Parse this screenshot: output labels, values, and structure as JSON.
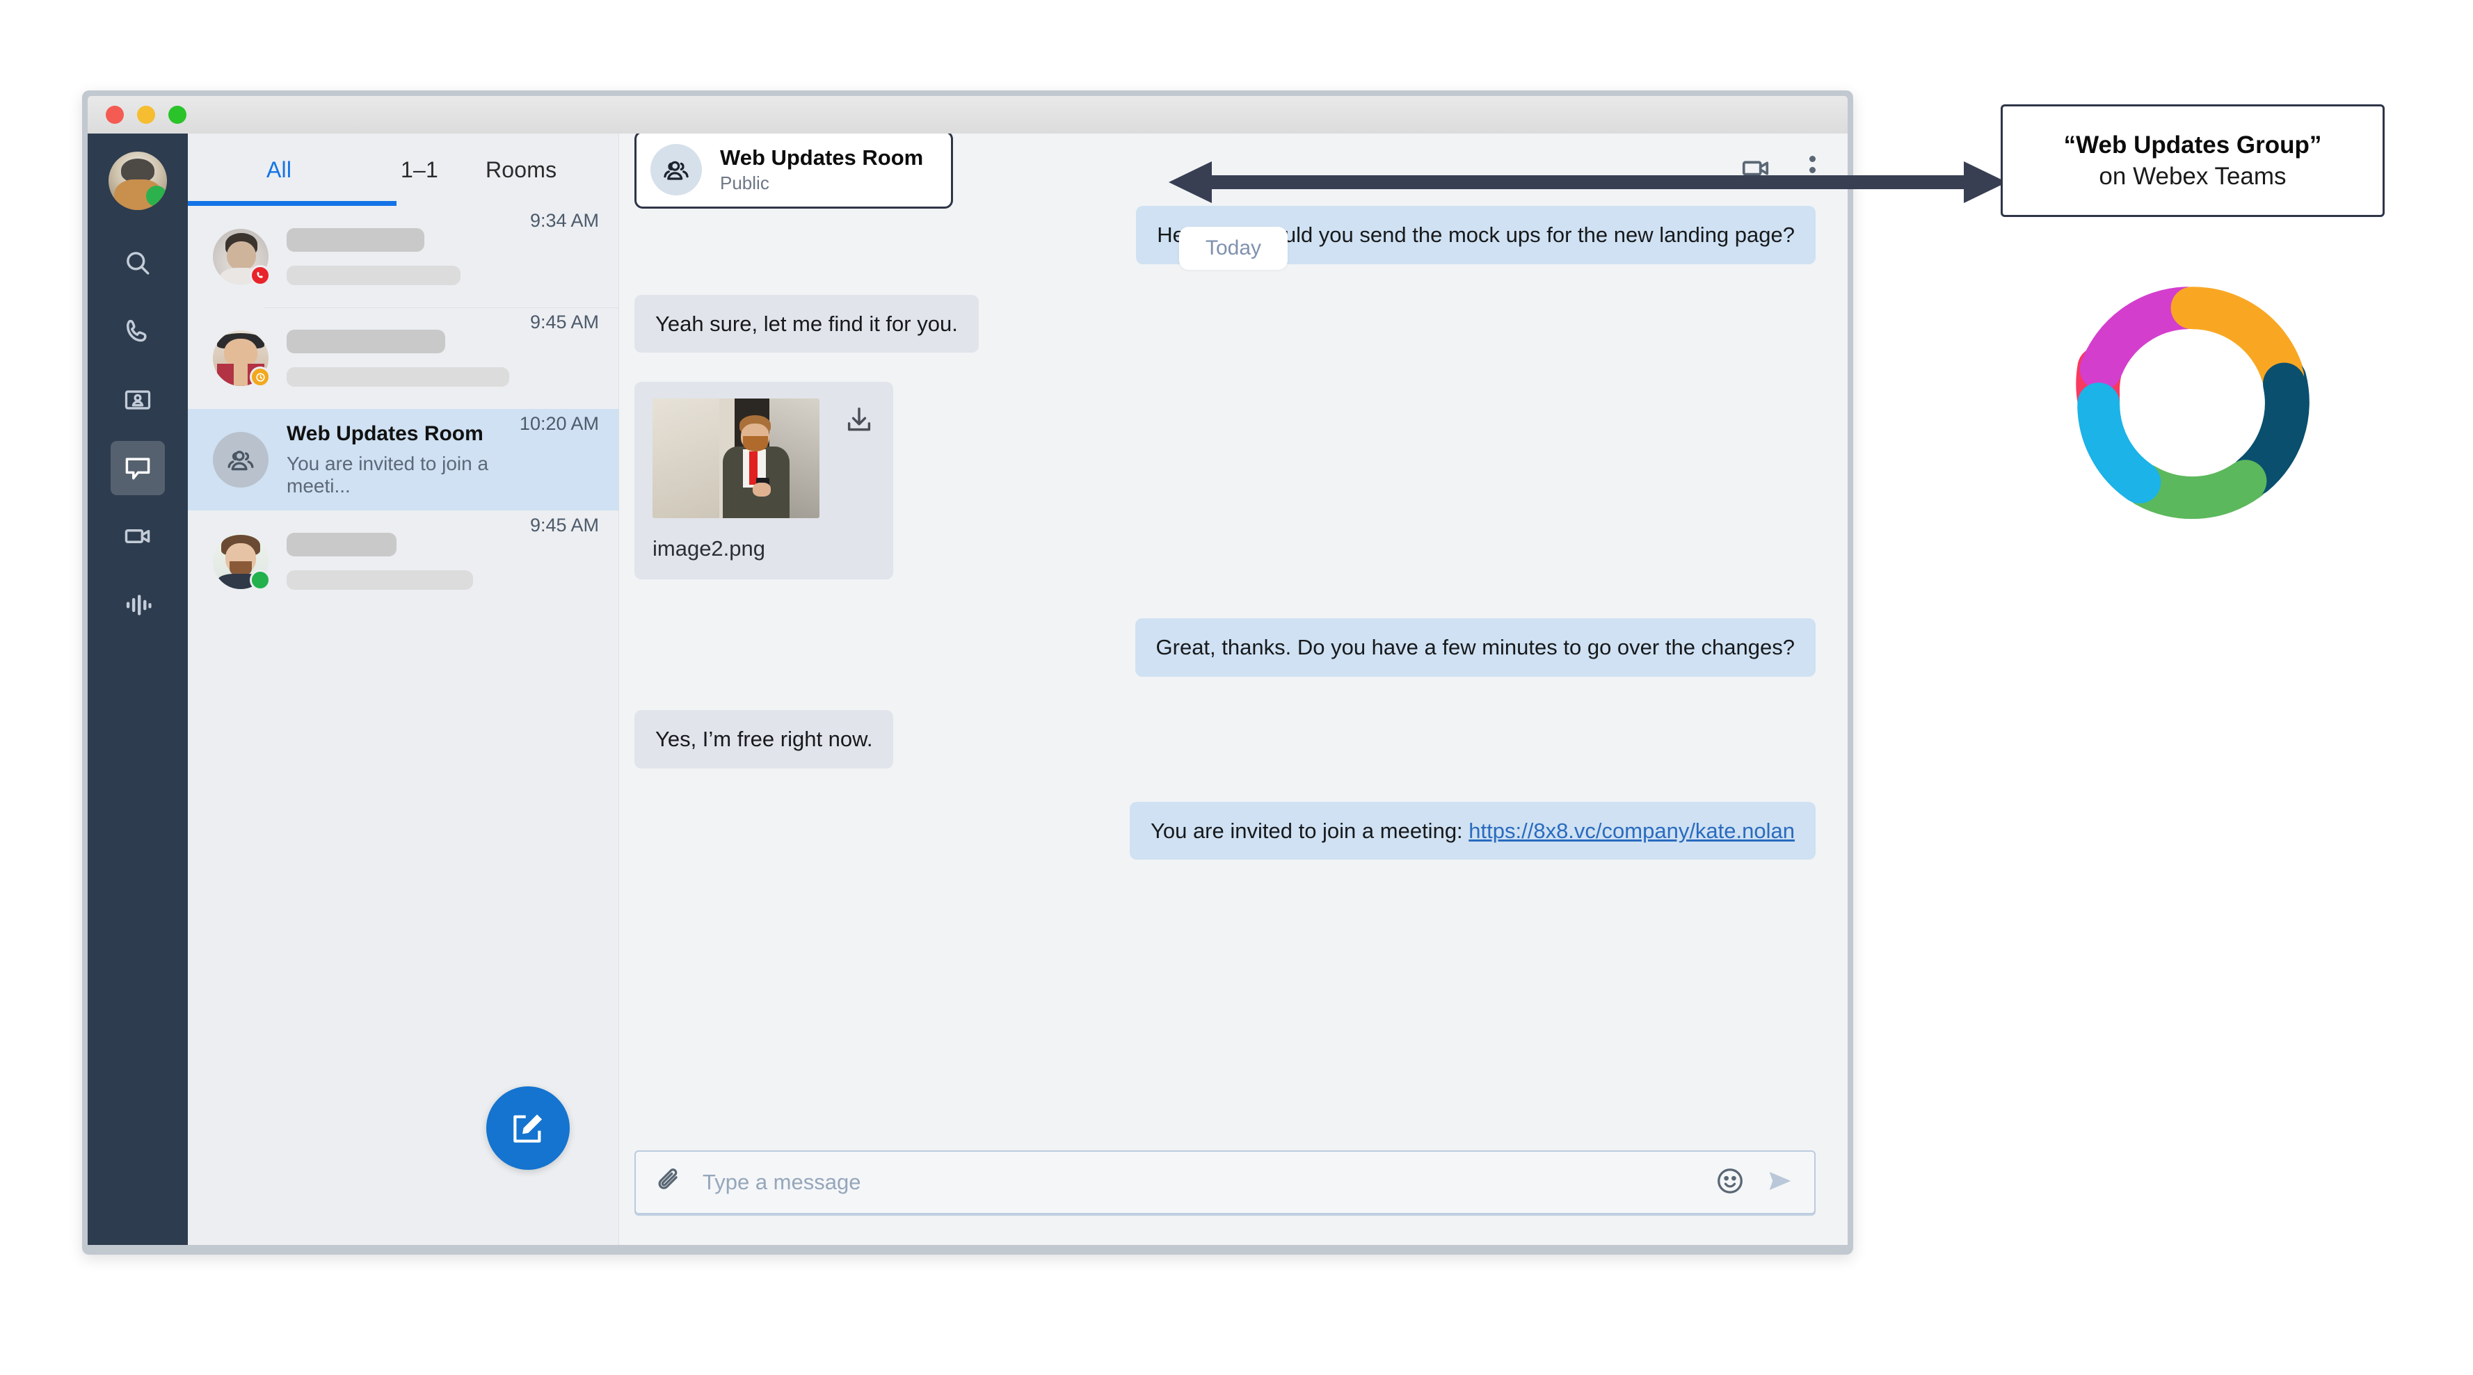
{
  "window": {
    "traffic_lights": [
      "close",
      "minimize",
      "maximize"
    ]
  },
  "rail": {
    "avatar_presence": "online",
    "items": [
      {
        "name": "search-icon",
        "label": "Search"
      },
      {
        "name": "phone-icon",
        "label": "Calls"
      },
      {
        "name": "contact-card-icon",
        "label": "Contacts"
      },
      {
        "name": "chat-icon",
        "label": "Messages",
        "active": true
      },
      {
        "name": "video-camera-icon",
        "label": "Meetings"
      },
      {
        "name": "analytics-icon",
        "label": "Analytics"
      }
    ]
  },
  "list": {
    "tabs": [
      {
        "label": "All",
        "active": true
      },
      {
        "label": "1–1",
        "active": false
      },
      {
        "label": "Rooms",
        "active": false
      }
    ],
    "conversations": [
      {
        "name_redacted": true,
        "time": "9:34 AM",
        "badge": "call",
        "selected": false
      },
      {
        "name_redacted": true,
        "time": "9:45 AM",
        "badge": "away",
        "selected": false
      },
      {
        "title": "Web Updates Room",
        "snippet": "You are invited to join a meeti...",
        "time": "10:20 AM",
        "badge": "none",
        "selected": true,
        "avatar": "group-icon"
      },
      {
        "name_redacted": true,
        "time": "9:45 AM",
        "badge": "online",
        "selected": false
      }
    ],
    "compose_button": "compose-icon"
  },
  "chat": {
    "room_title": "Web Updates Room",
    "room_subtitle": "Public",
    "room_icon": "group-icon",
    "actions": [
      {
        "name": "video-call-icon"
      },
      {
        "name": "more-options-icon"
      }
    ],
    "day_divider": "Today",
    "messages": [
      {
        "direction": "out",
        "text": "Hey Mark, could you send the mock ups for the new landing page?"
      },
      {
        "direction": "in",
        "text": "Yeah sure, let me find it for you."
      },
      {
        "direction": "in",
        "type": "attachment",
        "filename": "image2.png",
        "action": "download-icon"
      },
      {
        "direction": "out",
        "text": "Great, thanks. Do you have a few minutes to go over the changes?"
      },
      {
        "direction": "in",
        "text": "Yes, I’m free right now."
      },
      {
        "direction": "out",
        "type": "link",
        "text": "You are invited to join a meeting: ",
        "link_text": "https://8x8.vc/company/kate.nolan"
      }
    ],
    "composer": {
      "placeholder": "Type a message",
      "value": "",
      "attach_icon": "paperclip-icon",
      "emoji_icon": "emoji-icon",
      "send_icon": "send-icon"
    }
  },
  "annotation": {
    "callout_line1": "“Web Updates Group”",
    "callout_line2": "on Webex Teams",
    "arrow": "double-headed-arrow",
    "logo": "webex-ring-logo"
  },
  "colors": {
    "accent_blue": "#1474e6",
    "rail_bg": "#2d3c4e",
    "selected_row": "#cfe1f2",
    "bubble_out": "#cfe1f2",
    "bubble_in": "#e1e4ea",
    "annotation_stroke": "#2e3547",
    "logo_magenta": "#d43ecd",
    "logo_orange": "#f9a723",
    "logo_teal": "#0a4f6e",
    "logo_green": "#5cb85c",
    "logo_cyan": "#1bb3e8",
    "logo_pink": "#f9395f"
  }
}
